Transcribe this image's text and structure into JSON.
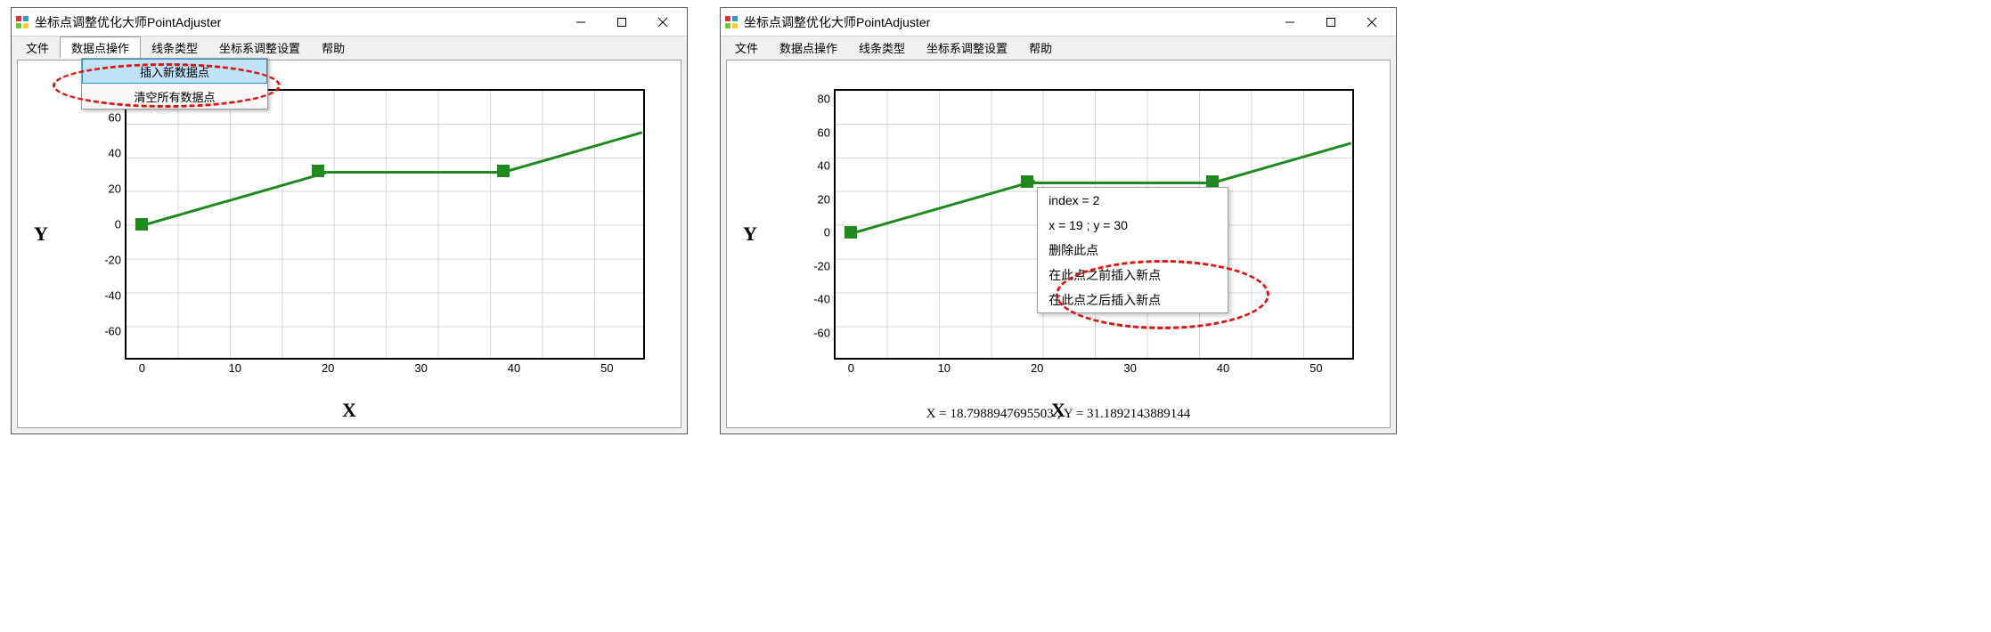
{
  "app_title": "坐标点调整优化大师PointAdjuster",
  "menus": {
    "file": "文件",
    "pointOps": "数据点操作",
    "lineType": "线条类型",
    "axisSettings": "坐标系调整设置",
    "help": "帮助"
  },
  "dropdown_pointOps": {
    "insert": "插入新数据点",
    "clearAll": "清空所有数据点"
  },
  "axes": {
    "x_label": "X",
    "y_label": "Y"
  },
  "left": {
    "y_ticks": [
      "60",
      "40",
      "20",
      "0",
      "-20",
      "-40",
      "-60"
    ],
    "x_ticks": [
      "0",
      "10",
      "20",
      "30",
      "40",
      "50"
    ]
  },
  "right": {
    "y_ticks": [
      "80",
      "60",
      "40",
      "20",
      "0",
      "-20",
      "-40",
      "-60"
    ],
    "x_ticks": [
      "0",
      "10",
      "20",
      "30",
      "40",
      "50"
    ],
    "context": {
      "l1": "index = 2",
      "l2": "x = 19 ; y = 30",
      "l3": "删除此点",
      "l4": "在此点之前插入新点",
      "l5": "在此点之后插入新点"
    },
    "status": "X = 18.7988947695503 ; Y = 31.1892143889144"
  },
  "chart_data": {
    "type": "line",
    "x": [
      0,
      19,
      40,
      55
    ],
    "y": [
      0,
      30,
      30,
      48
    ],
    "xlabel": "X",
    "ylabel": "Y",
    "xlim": [
      -2,
      56
    ],
    "ylim_left": [
      -75,
      75
    ],
    "ylim_right": [
      -75,
      85
    ],
    "series_color": "#1f8a1f",
    "marker": "square"
  }
}
